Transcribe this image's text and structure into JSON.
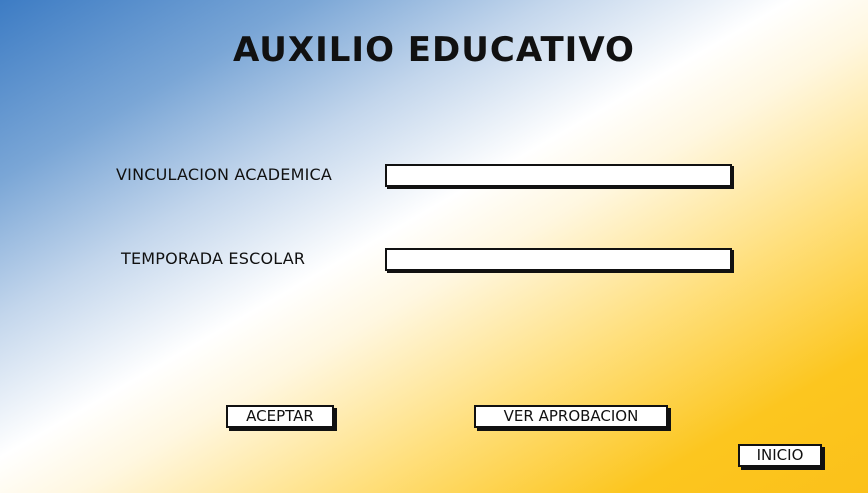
{
  "title": "AUXILIO EDUCATIVO",
  "form": {
    "vinculacion": {
      "label": "VINCULACION ACADEMICA",
      "value": "",
      "placeholder": ""
    },
    "temporada": {
      "label": "TEMPORADA ESCOLAR",
      "value": "",
      "placeholder": ""
    }
  },
  "buttons": {
    "accept": "ACEPTAR",
    "view_approval": "VER APROBACION",
    "home": "INICIO"
  },
  "colors": {
    "gradient_top_left": "#3d7cc4",
    "gradient_middle": "#ffffff",
    "gradient_bottom_right": "#fbc11a",
    "border": "#111111"
  }
}
